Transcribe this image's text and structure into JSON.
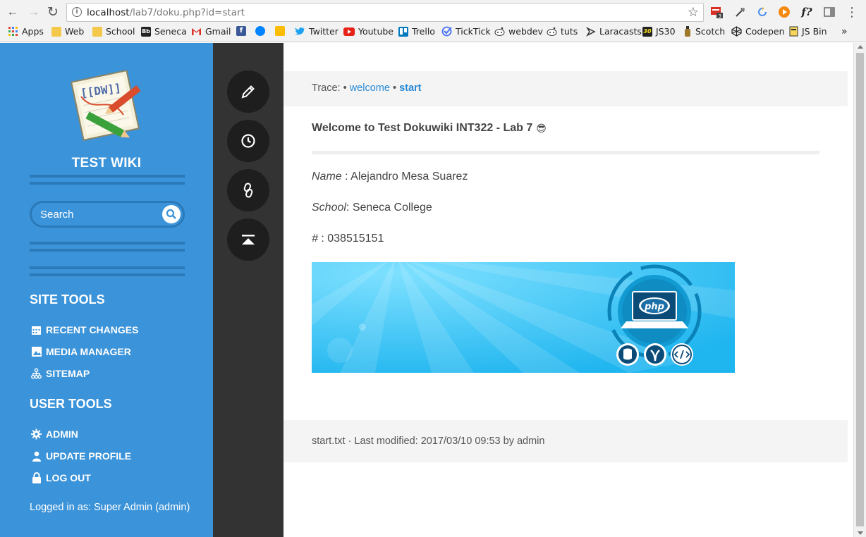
{
  "browser": {
    "url_host": "localhost",
    "url_path": "/lab7/doku.php?id=start",
    "extensions": [
      "gmail-counter-icon",
      "eyedropper-icon",
      "sync-icon",
      "play-icon",
      "fonts-icon",
      "sidebar-icon"
    ],
    "extension_badge": "3",
    "ext_fonts_label": "f?",
    "bookmarks": [
      {
        "label": "Apps",
        "icon": "apps-grid-icon"
      },
      {
        "label": "Web",
        "icon": "folder-icon"
      },
      {
        "label": "School",
        "icon": "folder-icon"
      },
      {
        "label": "Seneca",
        "icon": "blackboard-icon"
      },
      {
        "label": "Gmail",
        "icon": "gmail-icon"
      },
      {
        "label": "",
        "icon": "facebook-icon"
      },
      {
        "label": "",
        "icon": "messenger-icon"
      },
      {
        "label": "",
        "icon": "keep-icon"
      },
      {
        "label": "Twitter",
        "icon": "twitter-icon"
      },
      {
        "label": "Youtube",
        "icon": "youtube-icon"
      },
      {
        "label": "Trello",
        "icon": "trello-icon"
      },
      {
        "label": "TickTick",
        "icon": "ticktick-icon"
      },
      {
        "label": "webdev",
        "icon": "reddit-icon"
      },
      {
        "label": "tuts",
        "icon": "reddit-icon"
      },
      {
        "label": "Laracasts",
        "icon": "laracasts-icon"
      },
      {
        "label": "JS30",
        "icon": "js30-icon"
      },
      {
        "label": "Scotch",
        "icon": "scotch-icon"
      },
      {
        "label": "Codepen",
        "icon": "codepen-icon"
      },
      {
        "label": "JS Bin",
        "icon": "jsbin-icon"
      }
    ],
    "bookmark_glyphs": {
      "seneca": "Bb",
      "facebook": "f",
      "js30": "30"
    },
    "overflow_label": "»"
  },
  "sidebar": {
    "logo_text": "[[DW]]",
    "wiki_title": "TEST WIKI",
    "search_placeholder": "Search",
    "site_tools_heading": "SITE TOOLS",
    "site_tools": [
      {
        "label": "RECENT CHANGES",
        "icon": "calendar-icon"
      },
      {
        "label": "MEDIA MANAGER",
        "icon": "image-icon"
      },
      {
        "label": "SITEMAP",
        "icon": "sitemap-icon"
      }
    ],
    "user_tools_heading": "USER TOOLS",
    "user_tools": [
      {
        "label": "ADMIN",
        "icon": "gear-icon"
      },
      {
        "label": "UPDATE PROFILE",
        "icon": "user-icon"
      },
      {
        "label": "LOG OUT",
        "icon": "lock-icon"
      }
    ],
    "logged_in_text": "Logged in as: Super Admin (admin)"
  },
  "page_tools": [
    "edit-pencil-icon",
    "history-clock-icon",
    "backlinks-chain-icon",
    "back-to-top-icon"
  ],
  "content": {
    "trace_label": "Trace:",
    "trace_sep": "•",
    "trace_links": [
      "welcome",
      "start"
    ],
    "title": "Welcome to Test Dokuwiki INT322 - Lab 7",
    "title_emoji": "😎",
    "fields": [
      {
        "label": "Name",
        "sep": " : ",
        "value": "Alejandro Mesa Suarez"
      },
      {
        "label": "School",
        "sep": ": ",
        "value": "Seneca College"
      },
      {
        "label": "#",
        "sep": " : ",
        "value": "038515151"
      }
    ],
    "banner_logo_text": "php",
    "footer": "start.txt · Last modified: 2017/03/10 09:53 by admin"
  },
  "colors": {
    "sidebar_blue": "#3b93d9",
    "sidebar_dark": "#2a79b8",
    "tools_dark": "#333333",
    "link_blue": "#2b8bd6",
    "banner_sky": "#34c3f6"
  }
}
